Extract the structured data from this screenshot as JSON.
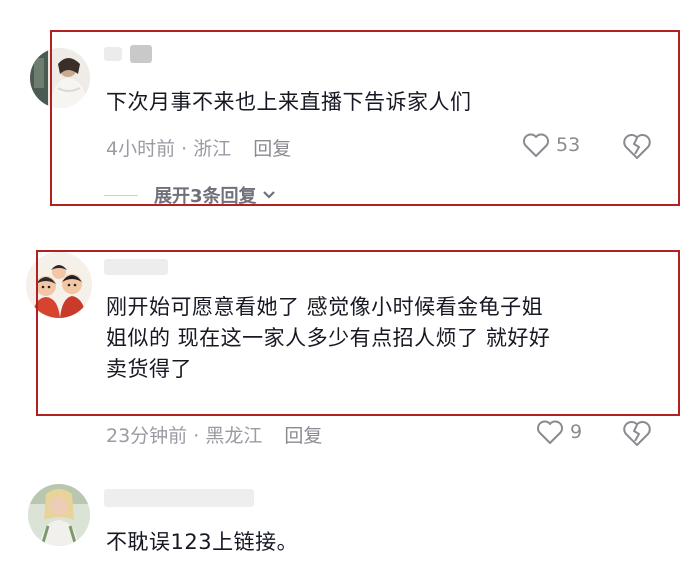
{
  "comments": [
    {
      "avatar": "woman-photo-avatar",
      "body": "下次月事不来也上来直播下告诉家人们",
      "time": "4小时前",
      "location": "浙江",
      "reply_label": "回复",
      "likes": "53",
      "expand_label": "展开3条回复"
    },
    {
      "avatar": "cartoon-family-avatar",
      "body_lines": [
        "刚开始可愿意看她了 感觉像小时候看金龟子姐",
        "姐似的 现在这一家人多少有点招人烦了 就好好",
        "卖货得了"
      ],
      "time": "23分钟前",
      "location": "黑龙江",
      "reply_label": "回复",
      "likes": "9"
    },
    {
      "avatar": "blonde-woman-avatar",
      "body": "不耽误123上链接。"
    }
  ],
  "separator": " · ",
  "colors": {
    "highlight_border": "#b32020",
    "meta_text": "#9a9ba3"
  }
}
